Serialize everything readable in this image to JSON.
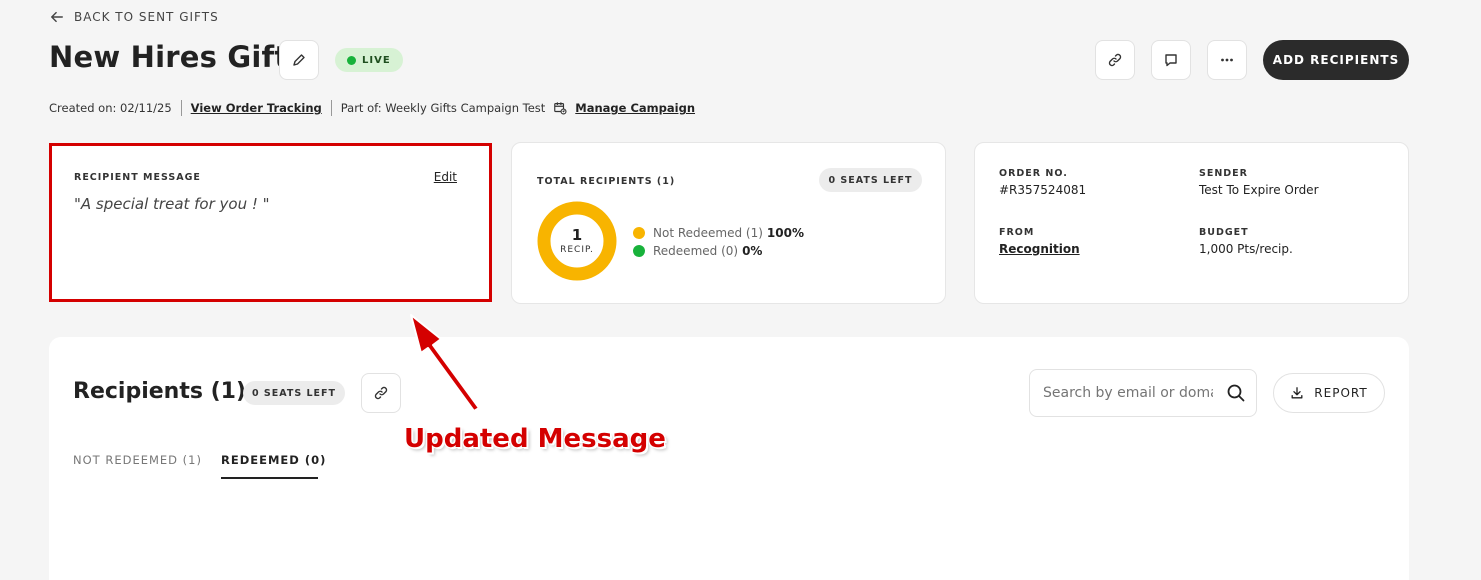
{
  "back_link": "BACK TO SENT GIFTS",
  "header": {
    "title": "New Hires Gift",
    "status": "LIVE",
    "add_recipients": "ADD RECIPIENTS"
  },
  "meta": {
    "created": "Created on: 02/11/25",
    "order_tracking": "View Order Tracking",
    "part_of": "Part of: Weekly Gifts Campaign Test",
    "manage_campaign": "Manage Campaign"
  },
  "message_card": {
    "label": "RECIPIENT MESSAGE",
    "edit": "Edit",
    "message": "\"A special treat for you ! \""
  },
  "totals_card": {
    "label": "TOTAL RECIPIENTS (1)",
    "seats": "0 SEATS LEFT",
    "donut_count": "1",
    "donut_unit": "RECIP.",
    "legend": [
      {
        "label": "Not Redeemed (1)",
        "pct": "100%",
        "color": "#f8b400",
        "value": 1
      },
      {
        "label": "Redeemed (0)",
        "pct": "0%",
        "color": "#18b23b",
        "value": 0
      }
    ]
  },
  "order_card": {
    "order_no_label": "ORDER NO.",
    "order_no": "#R357524081",
    "sender_label": "SENDER",
    "sender": "Test To Expire Order",
    "from_label": "FROM",
    "from": "Recognition",
    "budget_label": "BUDGET",
    "budget": "1,000 Pts/recip."
  },
  "recipients": {
    "title": "Recipients (1)",
    "seats": "0 SEATS LEFT",
    "search_placeholder": "Search by email or doma",
    "report": "REPORT",
    "tabs": [
      {
        "label": "NOT REDEEMED (1)",
        "active": false
      },
      {
        "label": "REDEEMED (0)",
        "active": true
      }
    ]
  },
  "annotation": {
    "text": "Updated Message",
    "color": "#d40000"
  },
  "colors": {
    "accent_dark": "#2b2b2b",
    "live_bg": "#d7f2d4",
    "live_dot": "#18b23b",
    "not_redeemed": "#f8b400",
    "redeemed": "#18b23b"
  }
}
